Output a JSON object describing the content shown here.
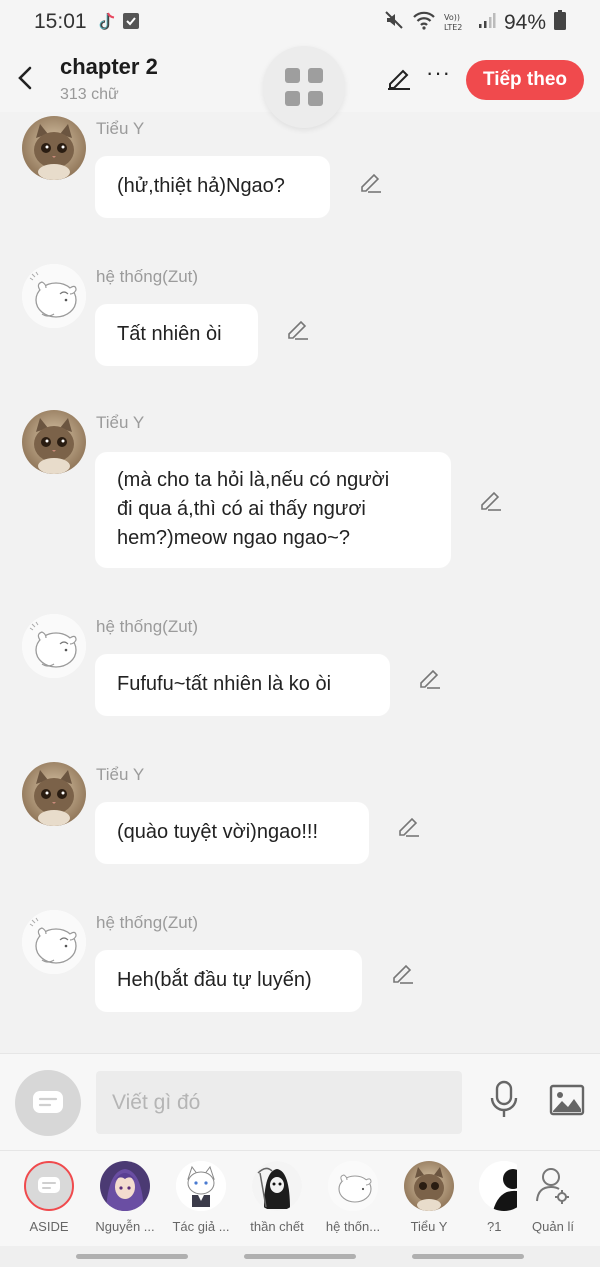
{
  "status_bar": {
    "time": "15:01",
    "lte": "VoLTE2",
    "battery": "94%"
  },
  "header": {
    "title": "chapter 2",
    "word_count": "313 chữ",
    "next_label": "Tiếp theo"
  },
  "messages": [
    {
      "sender": "Tiểu Y",
      "avatar": "cat-avatar",
      "lines": [
        "(hử,thiệt hả)Ngao?"
      ]
    },
    {
      "sender": "hệ thống(Zut)",
      "avatar": "hamster-avatar",
      "lines": [
        "Tất nhiên òi"
      ]
    },
    {
      "sender": "Tiểu Y",
      "avatar": "cat-avatar",
      "lines": [
        "(mà cho ta hỏi là,nếu có người",
        "đi qua á,thì có ai thấy ngươi",
        "hem?)meow ngao ngao~?"
      ]
    },
    {
      "sender": "hệ thống(Zut)",
      "avatar": "hamster-avatar",
      "lines": [
        "Fufufu~tất nhiên là ko òi"
      ]
    },
    {
      "sender": "Tiểu Y",
      "avatar": "cat-avatar",
      "lines": [
        "(quào tuyệt vời)ngao!!!"
      ]
    },
    {
      "sender": "hệ thống(Zut)",
      "avatar": "hamster-avatar",
      "lines": [
        "Heh(bắt đầu tự luyến)"
      ]
    }
  ],
  "input": {
    "placeholder": "Viết gì đó"
  },
  "characters": [
    {
      "name": "ASIDE",
      "avatar": "aside-icon"
    },
    {
      "name": "Nguyễn ...",
      "avatar": "anime-girl-avatar"
    },
    {
      "name": "Tác giả ...",
      "avatar": "white-cat-avatar"
    },
    {
      "name": "thần chết",
      "avatar": "reaper-avatar"
    },
    {
      "name": "hệ thốn...",
      "avatar": "hamster-avatar"
    },
    {
      "name": "Tiểu Y",
      "avatar": "cat-avatar"
    },
    {
      "name": "?1",
      "avatar": "silhouette-avatar"
    },
    {
      "name": "Quản lí",
      "avatar": "manage-users-icon"
    }
  ],
  "colors": {
    "accent": "#f04a4d",
    "background": "#f2f2f2",
    "bubble": "#ffffff",
    "muted_text": "#9b9b9b"
  }
}
